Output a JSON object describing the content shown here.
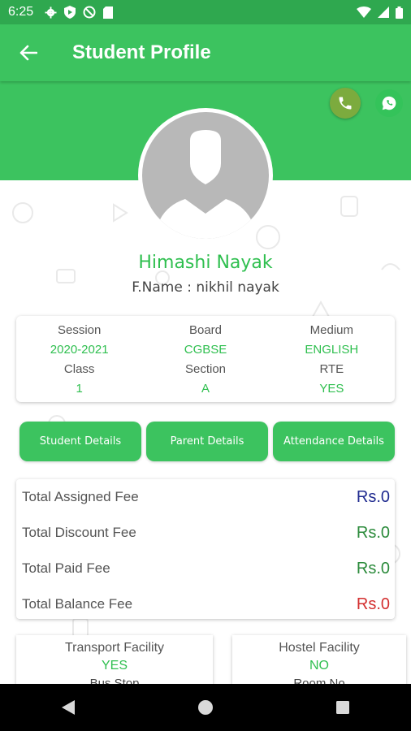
{
  "status_bar": {
    "time": "6:25",
    "left_icons": [
      "gear-icon",
      "play-protect-icon",
      "at-sign-icon",
      "sd-card-icon"
    ],
    "right_icons": [
      "wifi-icon",
      "signal-icon",
      "battery-icon"
    ]
  },
  "app_bar": {
    "title": "Student Profile",
    "back_icon": "arrow-left-icon"
  },
  "actions": {
    "call_icon": "phone-icon",
    "whatsapp_icon": "whatsapp-icon"
  },
  "profile": {
    "name": "Himashi Nayak",
    "father_name": "F.Name : nikhil nayak",
    "avatar_icon": "person-placeholder-icon"
  },
  "info": {
    "session_label": "Session",
    "session_value": "2020-2021",
    "board_label": "Board",
    "board_value": "CGBSE",
    "medium_label": "Medium",
    "medium_value": "ENGLISH",
    "class_label": "Class",
    "class_value": "1",
    "section_label": "Section",
    "section_value": "A",
    "rte_label": "RTE",
    "rte_value": "YES"
  },
  "tabs": [
    {
      "label": "Student Details"
    },
    {
      "label": "Parent Details"
    },
    {
      "label": "Attendance Details"
    }
  ],
  "fees": {
    "assigned_label": "Total Assigned Fee",
    "assigned_value": "Rs.0",
    "discount_label": "Total Discount Fee",
    "discount_value": "Rs.0",
    "paid_label": "Total Paid Fee",
    "paid_value": "Rs.0",
    "balance_label": "Total Balance Fee",
    "balance_value": "Rs.0"
  },
  "facilities": {
    "transport_label": "Transport Facility",
    "transport_value": "YES",
    "transport_sub": "Bus Stop",
    "hostel_label": "Hostel Facility",
    "hostel_value": "NO",
    "hostel_sub": "Room No"
  },
  "nav": [
    "back-triangle-icon",
    "home-circle-icon",
    "recents-square-icon"
  ],
  "colors": {
    "primary": "#3cc35f",
    "status_bar": "#2fa84f",
    "accent_text": "#2fbf4f",
    "assigned_value": "#1f2a8f",
    "discount_value": "#2a8a3a",
    "paid_value": "#2a8a3a",
    "balance_value": "#d32f2f"
  }
}
